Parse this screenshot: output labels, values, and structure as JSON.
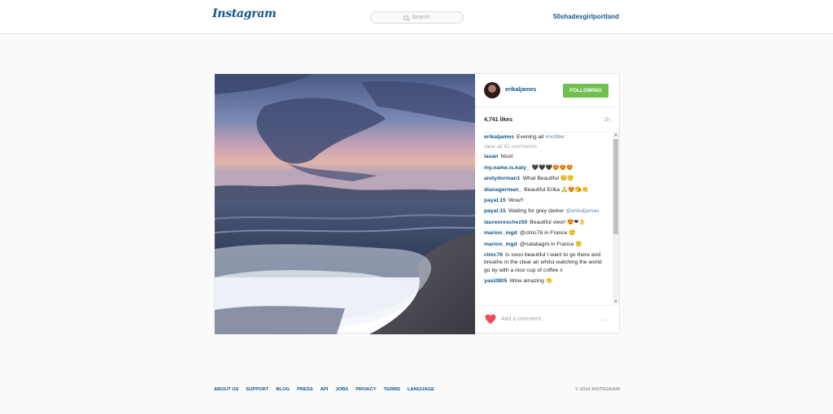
{
  "header": {
    "logo": "Instagram",
    "search_placeholder": "Search",
    "username": "50shadesgirlportland"
  },
  "post": {
    "author": "erikaljames",
    "follow_label": "FOLLOWING",
    "likes": "4,741 likes",
    "age": "1h",
    "caption_user": "erikaljames",
    "caption_text": "Evening all",
    "caption_tag": "#nofilter",
    "view_all": "view all 42 comments",
    "comments": [
      {
        "user": "lasan",
        "text": "Nice!",
        "mention": ""
      },
      {
        "user": "my.name.is.katy_",
        "text": "🖤🖤🖤😍😍😍",
        "mention": ""
      },
      {
        "user": "andydorman1",
        "text": "What Beautiful 😊🙂",
        "mention": ""
      },
      {
        "user": "dianagerman_",
        "text": "Beautiful Erika 🙏😍😘👏",
        "mention": ""
      },
      {
        "user": "payal.15",
        "text": "Wow!!",
        "mention": ""
      },
      {
        "user": "payal.15",
        "text": "Waiting for grey darker",
        "mention": "@erikaljames"
      },
      {
        "user": "laureoreschez50",
        "text": "Beautiful view! 😍❤👌",
        "mention": ""
      },
      {
        "user": "marion_mgd",
        "text": "@clmc76 in France 🙂",
        "mention": ""
      },
      {
        "user": "marion_mgd",
        "text": "@nataliagm in France 🙂",
        "mention": ""
      },
      {
        "user": "clmc76",
        "text": "Is sooo beautiful I want to go there and breathe in the clear air whilst watching the world go by with a nice cup of coffee x",
        "mention": ""
      },
      {
        "user": "yasi2805",
        "text": "Wow amazing 👏",
        "mention": ""
      }
    ],
    "add_comment_placeholder": "Add a comment...",
    "more": "···"
  },
  "footer": {
    "links": [
      "ABOUT US",
      "SUPPORT",
      "BLOG",
      "PRESS",
      "API",
      "JOBS",
      "PRIVACY",
      "TERMS",
      "LANGUAGE"
    ],
    "copyright": "© 2016 INSTAGRAM"
  },
  "colors": {
    "brand_blue": "#125688",
    "follow_green": "#70c050",
    "heart_red": "#ed4956"
  }
}
